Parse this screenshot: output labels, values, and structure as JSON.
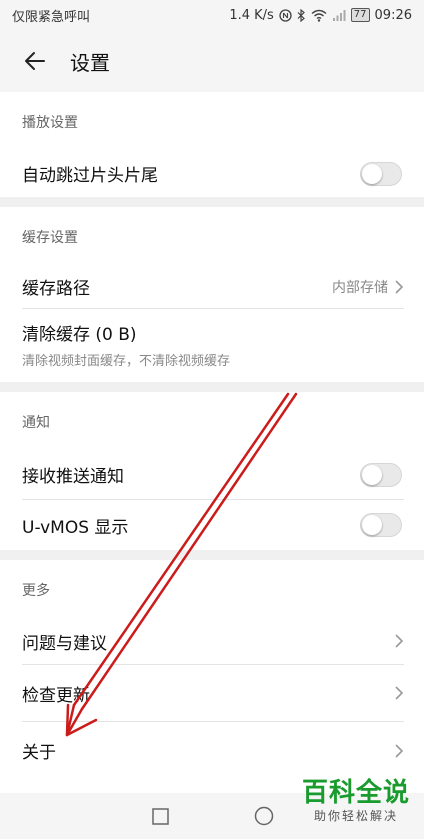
{
  "status_bar": {
    "carrier": "仅限紧急呼叫",
    "speed": "1.4 K/s",
    "battery": "77",
    "time": "09:26"
  },
  "header": {
    "title": "设置",
    "back_icon": "arrow-left-icon"
  },
  "sections": {
    "playback": {
      "header": "播放设置",
      "auto_skip": {
        "label": "自动跳过片头片尾",
        "enabled": false
      }
    },
    "cache": {
      "header": "缓存设置",
      "path": {
        "label": "缓存路径",
        "value": "内部存储"
      },
      "clear": {
        "label": "清除缓存 (0 B)",
        "description": "清除视频封面缓存，不清除视频缓存"
      }
    },
    "notify": {
      "header": "通知",
      "push": {
        "label": "接收推送通知",
        "enabled": false
      },
      "uvmos": {
        "label": "U-vMOS 显示",
        "enabled": false
      }
    },
    "more": {
      "header": "更多",
      "feedback": {
        "label": "问题与建议"
      },
      "update": {
        "label": "检查更新"
      },
      "about": {
        "label": "关于"
      }
    }
  },
  "annotation": {
    "color": "#cc1b1b"
  },
  "watermark": {
    "main": "百科全说",
    "sub": "助你轻松解决"
  }
}
